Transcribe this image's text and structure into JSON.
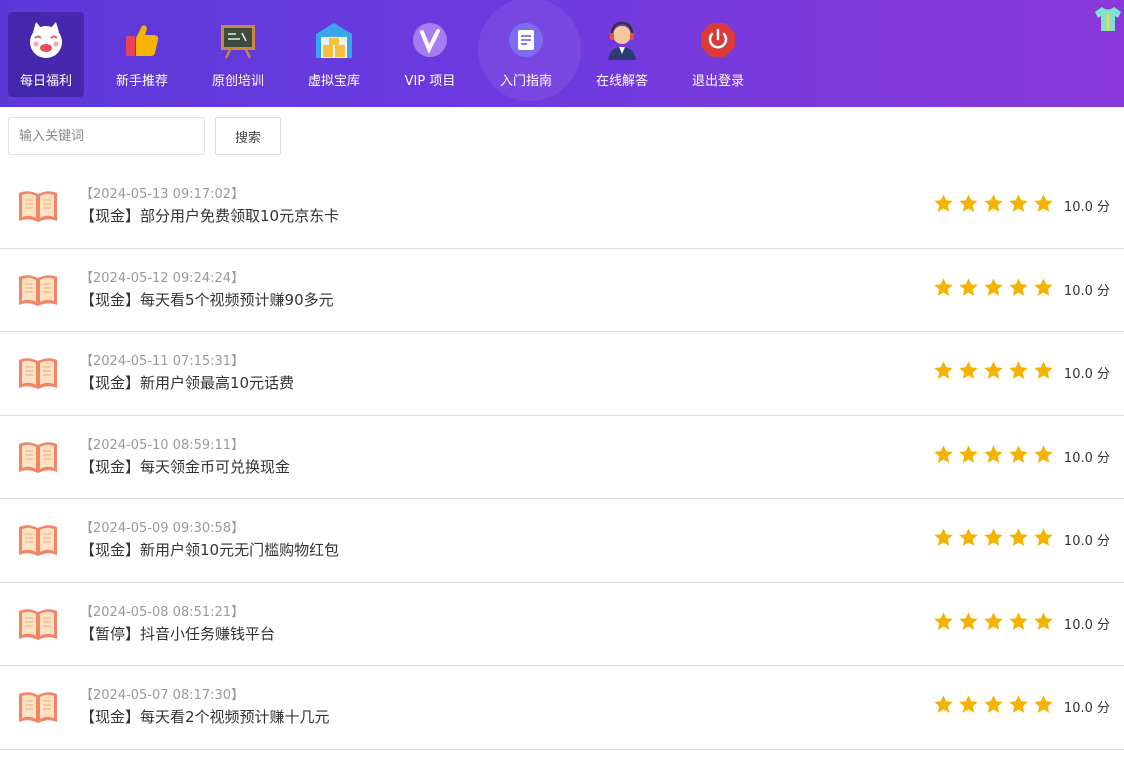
{
  "nav": {
    "items": [
      {
        "label": "每日福利",
        "icon": "lucky-cat-icon",
        "active": true
      },
      {
        "label": "新手推荐",
        "icon": "thumbs-up-icon",
        "active": false
      },
      {
        "label": "原创培训",
        "icon": "blackboard-icon",
        "active": false
      },
      {
        "label": "虚拟宝库",
        "icon": "warehouse-icon",
        "active": false
      },
      {
        "label": "VIP 项目",
        "icon": "vip-icon",
        "active": false
      },
      {
        "label": "入门指南",
        "icon": "document-icon",
        "active": false
      },
      {
        "label": "在线解答",
        "icon": "support-agent-icon",
        "active": false
      },
      {
        "label": "退出登录",
        "icon": "power-icon",
        "active": false
      }
    ],
    "corner_icon": "tshirt-icon"
  },
  "search": {
    "placeholder": "输入关键词",
    "value": "",
    "button_label": "搜索"
  },
  "list": {
    "items": [
      {
        "date": "【2024-05-13 09:17:02】",
        "title": "【现金】部分用户免费领取10元京东卡",
        "rating": 5,
        "score": "10.0 分"
      },
      {
        "date": "【2024-05-12 09:24:24】",
        "title": "【现金】每天看5个视频预计赚90多元",
        "rating": 5,
        "score": "10.0 分"
      },
      {
        "date": "【2024-05-11 07:15:31】",
        "title": "【现金】新用户领最高10元话费",
        "rating": 5,
        "score": "10.0 分"
      },
      {
        "date": "【2024-05-10 08:59:11】",
        "title": "【现金】每天领金币可兑换现金",
        "rating": 5,
        "score": "10.0 分"
      },
      {
        "date": "【2024-05-09 09:30:58】",
        "title": "【现金】新用户领10元无门槛购物红包",
        "rating": 5,
        "score": "10.0 分"
      },
      {
        "date": "【2024-05-08 08:51:21】",
        "title": "【暂停】抖音小任务赚钱平台",
        "rating": 5,
        "score": "10.0 分"
      },
      {
        "date": "【2024-05-07 08:17:30】",
        "title": "【现金】每天看2个视频预计赚十几元",
        "rating": 5,
        "score": "10.0 分"
      }
    ]
  },
  "colors": {
    "header_start": "#5b39d8",
    "header_end": "#8a38d9",
    "star": "#f5b301",
    "book": "#f08a6e"
  }
}
